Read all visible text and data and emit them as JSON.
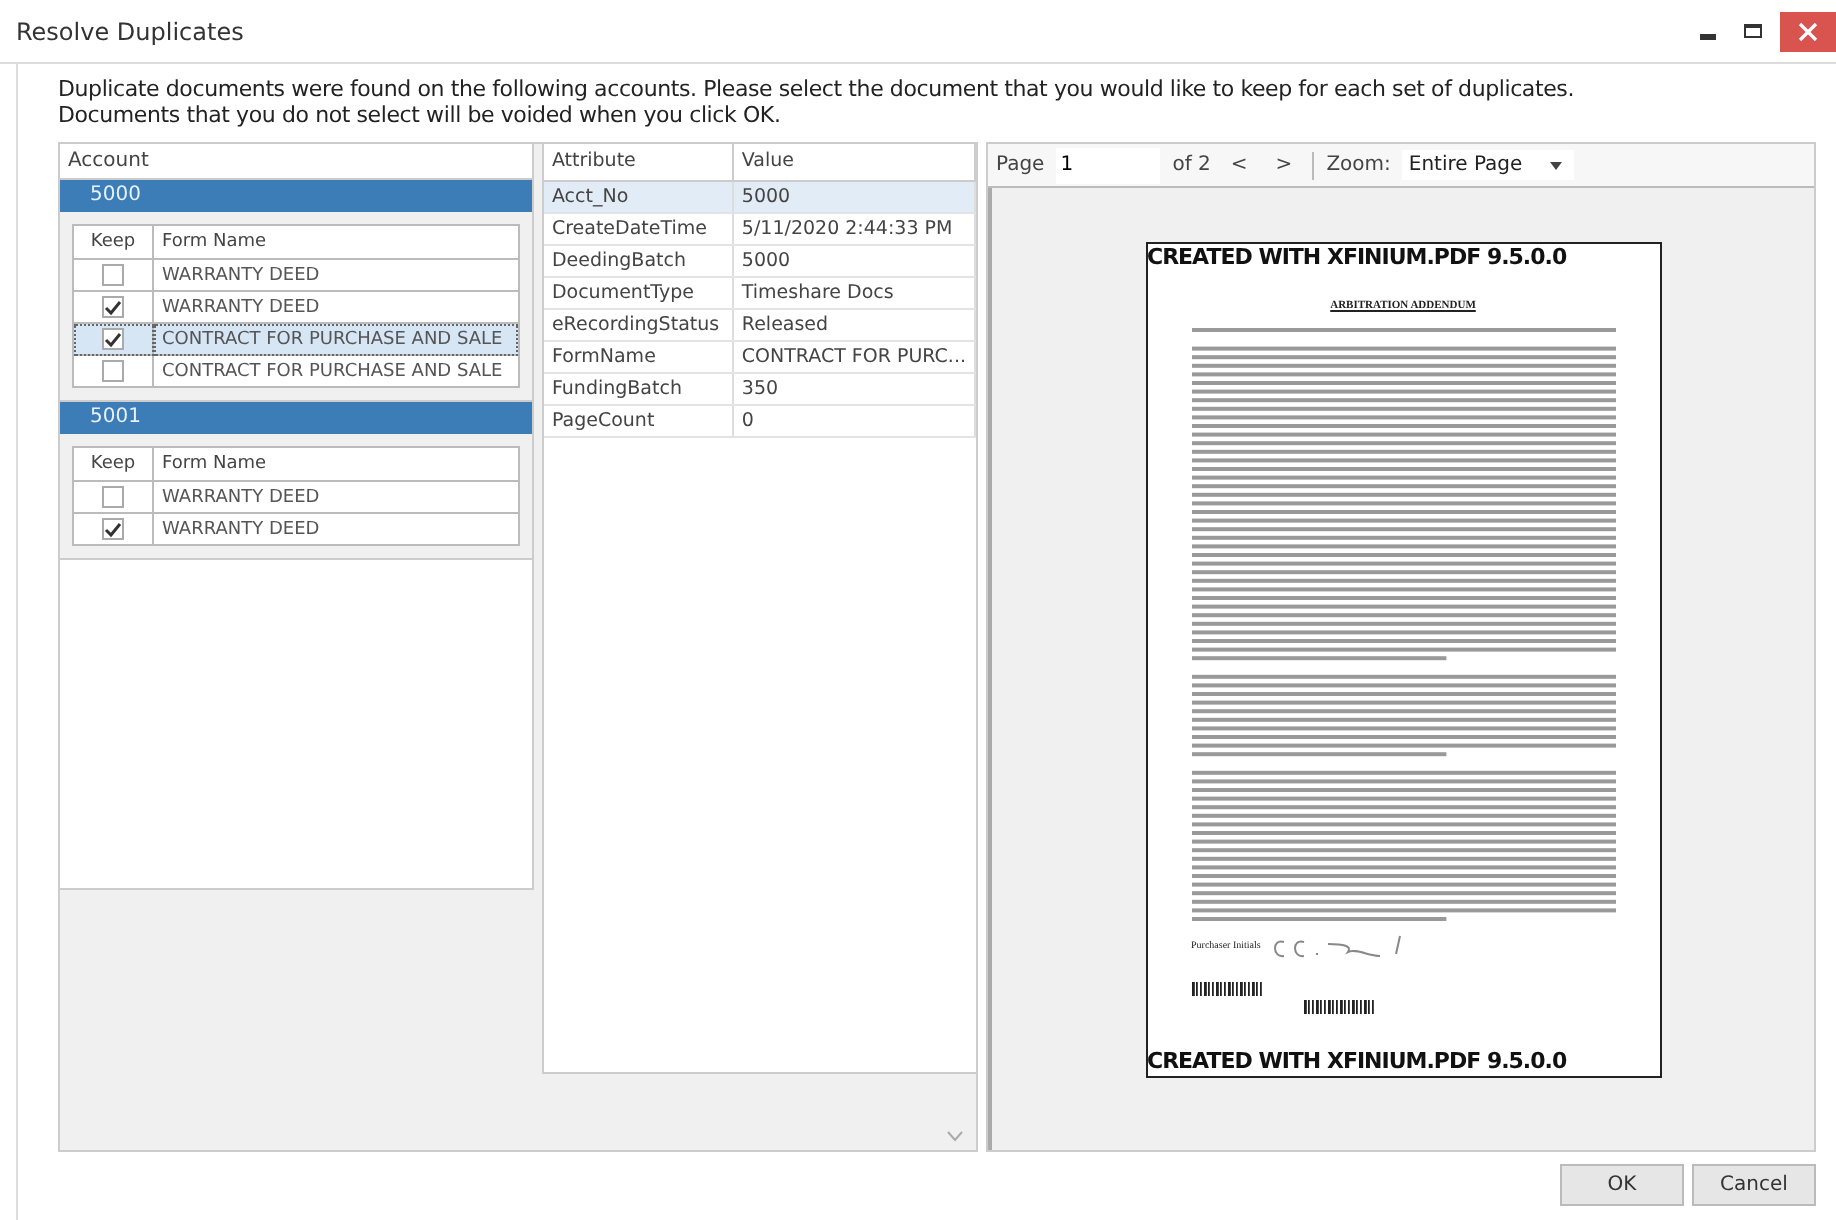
{
  "window": {
    "title": "Resolve Duplicates"
  },
  "instructions": [
    "Duplicate documents were found on the following accounts. Please select the document that you would like to keep for each set of duplicates.",
    "Documents that you do not select will be voided when you click OK."
  ],
  "accounts_header": "Account",
  "accounts": [
    {
      "account": "5000",
      "columns": [
        "Keep",
        "Form Name"
      ],
      "rows": [
        {
          "keep": false,
          "form_name": "WARRANTY DEED",
          "selected": false
        },
        {
          "keep": true,
          "form_name": "WARRANTY DEED",
          "selected": false
        },
        {
          "keep": true,
          "form_name": "CONTRACT FOR PURCHASE AND SALE",
          "selected": true
        },
        {
          "keep": false,
          "form_name": "CONTRACT FOR PURCHASE AND SALE",
          "selected": false
        }
      ]
    },
    {
      "account": "5001",
      "columns": [
        "Keep",
        "Form Name"
      ],
      "rows": [
        {
          "keep": false,
          "form_name": "WARRANTY DEED",
          "selected": false
        },
        {
          "keep": true,
          "form_name": "WARRANTY DEED",
          "selected": false
        }
      ]
    }
  ],
  "attributes": {
    "columns": [
      "Attribute",
      "Value"
    ],
    "rows": [
      {
        "attribute": "Acct_No",
        "value": "5000",
        "selected": true
      },
      {
        "attribute": "CreateDateTime",
        "value": "5/11/2020 2:44:33 PM",
        "selected": false
      },
      {
        "attribute": "DeedingBatch",
        "value": "5000",
        "selected": false
      },
      {
        "attribute": "DocumentType",
        "value": "Timeshare Docs",
        "selected": false
      },
      {
        "attribute": "eRecordingStatus",
        "value": "Released",
        "selected": false
      },
      {
        "attribute": "FormName",
        "value": "CONTRACT FOR PURC...",
        "selected": false
      },
      {
        "attribute": "FundingBatch",
        "value": "350",
        "selected": false
      },
      {
        "attribute": "PageCount",
        "value": "0",
        "selected": false
      }
    ]
  },
  "viewer": {
    "page_label": "Page",
    "page": "1",
    "of_pages": "of 2",
    "prev": "<",
    "next": ">",
    "zoom_label": "Zoom:",
    "zoom": "Entire Page",
    "document": {
      "watermark_top": "CREATED WITH XFINIUM.PDF  9.5.0.0",
      "heading": "ARBITRATION ADDENDUM",
      "initials_label": "Purchaser Initials",
      "watermark_bottom": "CREATED WITH XFINIUM.PDF  9.5.0.0"
    }
  },
  "buttons": [
    "OK",
    "Cancel"
  ]
}
